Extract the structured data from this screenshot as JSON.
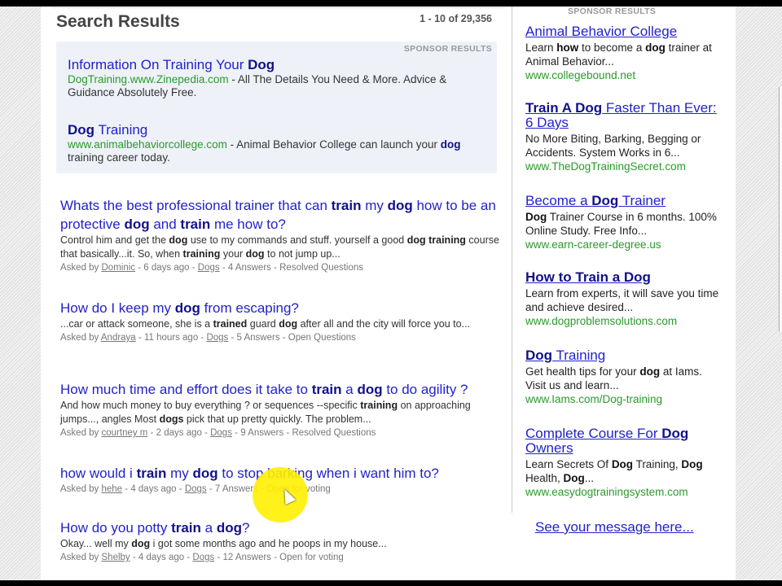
{
  "header": {
    "title": "Search Results",
    "count": "1 - 10 of 29,356"
  },
  "sponsor_label": "SPONSOR RESULTS",
  "top_ads": [
    {
      "title": [
        {
          "t": "Information On Training Your "
        },
        {
          "t": "Dog",
          "b": true
        }
      ],
      "url": "DogTraining.www.Zinepedia.com",
      "desc": [
        {
          "t": " - All The Details You Need & More. Advice & Guidance Absolutely Free."
        }
      ]
    },
    {
      "title": [
        {
          "t": "Dog",
          "b": true
        },
        {
          "t": " Training"
        }
      ],
      "url": "www.animalbehaviorcollege.com",
      "desc": [
        {
          "t": " - Animal Behavior College can launch your "
        },
        {
          "t": "dog",
          "b": true
        },
        {
          "t": " training career today."
        }
      ]
    }
  ],
  "results": [
    {
      "title": [
        {
          "t": "Whats the best professional trainer that can "
        },
        {
          "t": "train",
          "b": true
        },
        {
          "t": " my "
        },
        {
          "t": "dog",
          "b": true
        },
        {
          "t": " how to be an protective "
        },
        {
          "t": "dog",
          "b": true
        },
        {
          "t": " and "
        },
        {
          "t": "train",
          "b": true
        },
        {
          "t": " me how to?"
        }
      ],
      "snippet": [
        {
          "t": "Control him and get the "
        },
        {
          "t": "dog",
          "b": true
        },
        {
          "t": " use to my commands and stuff. yourself a good "
        },
        {
          "t": "dog",
          "b": true
        },
        {
          "t": " "
        },
        {
          "t": "training",
          "b": true
        },
        {
          "t": " course that basically...it. So, when "
        },
        {
          "t": "training",
          "b": true
        },
        {
          "t": " your "
        },
        {
          "t": "dog",
          "b": true
        },
        {
          "t": " to not jump up..."
        }
      ],
      "asked_by": "Asked by ",
      "user": "Dominic",
      "time": " - 6 days ago - ",
      "category": "Dogs",
      "tail": " - 4 Answers - Resolved Questions"
    },
    {
      "title": [
        {
          "t": "How do I keep my "
        },
        {
          "t": "dog",
          "b": true
        },
        {
          "t": " from escaping?"
        }
      ],
      "snippet": [
        {
          "t": "...car or attack someone, she is a "
        },
        {
          "t": "trained",
          "b": true
        },
        {
          "t": " guard "
        },
        {
          "t": "dog",
          "b": true
        },
        {
          "t": " after all and the city will force you to..."
        }
      ],
      "asked_by": "Asked by ",
      "user": "Andraya",
      "time": " - 11 hours ago - ",
      "category": "Dogs",
      "tail": " - 5 Answers - Open Questions"
    },
    {
      "title": [
        {
          "t": "How much time and effort does it take to "
        },
        {
          "t": "train",
          "b": true
        },
        {
          "t": " a "
        },
        {
          "t": "dog",
          "b": true
        },
        {
          "t": " to do agility ?"
        }
      ],
      "snippet": [
        {
          "t": "And how much money to buy everything ? or sequences --specific "
        },
        {
          "t": "training",
          "b": true
        },
        {
          "t": " on approaching jumps..., angles Most "
        },
        {
          "t": "dogs",
          "b": true
        },
        {
          "t": " pick that up pretty quickly. The problem..."
        }
      ],
      "asked_by": "Asked by ",
      "user": "courtney m",
      "time": " - 2 days ago - ",
      "category": "Dogs",
      "tail": " - 9 Answers - Resolved Questions"
    },
    {
      "title": [
        {
          "t": "how would i "
        },
        {
          "t": "train",
          "b": true
        },
        {
          "t": " my "
        },
        {
          "t": "dog",
          "b": true
        },
        {
          "t": " to stop barking when i want him to?"
        }
      ],
      "snippet": [],
      "asked_by": "Asked by ",
      "user": "hehe",
      "time": " - 4 days ago - ",
      "category": "Dogs",
      "tail": " - 7 Answers - Open for voting"
    },
    {
      "title": [
        {
          "t": "How do you potty "
        },
        {
          "t": "train",
          "b": true
        },
        {
          "t": " a "
        },
        {
          "t": "dog",
          "b": true
        },
        {
          "t": "?"
        }
      ],
      "snippet": [
        {
          "t": "Okay... well my "
        },
        {
          "t": "dog",
          "b": true
        },
        {
          "t": " i got some months ago and he poops in my house..."
        }
      ],
      "asked_by": "Asked by ",
      "user": "Shelby",
      "time": " - 4 days ago - ",
      "category": "Dogs",
      "tail": " - 12 Answers - Open for voting"
    }
  ],
  "side_ads": [
    {
      "title": [
        {
          "t": "Animal Behavior College"
        }
      ],
      "desc": [
        {
          "t": "Learn "
        },
        {
          "t": "how",
          "b": true
        },
        {
          "t": " to become a "
        },
        {
          "t": "dog",
          "b": true
        },
        {
          "t": " trainer at Animal Behavior..."
        }
      ],
      "url": "www.collegebound.net"
    },
    {
      "title": [
        {
          "t": "Train A Dog",
          "b": true
        },
        {
          "t": " Faster Than Ever: 6 Days"
        }
      ],
      "desc": [
        {
          "t": "No More Biting, Barking, Begging or Accidents. System Works in 6..."
        }
      ],
      "url": "www.TheDogTrainingSecret.com"
    },
    {
      "title": [
        {
          "t": "Become a "
        },
        {
          "t": "Dog",
          "b": true
        },
        {
          "t": " Trainer"
        }
      ],
      "desc": [
        {
          "t": "Dog",
          "b": true
        },
        {
          "t": " Trainer Course in 6 months. 100% Online Study. Free Info..."
        }
      ],
      "url": "www.earn-career-degree.us"
    },
    {
      "title": [
        {
          "t": "How to Train a Dog",
          "b": true
        }
      ],
      "desc": [
        {
          "t": "Learn from experts, it will save you time and achieve desired..."
        }
      ],
      "url": "www.dogproblemsolutions.com"
    },
    {
      "title": [
        {
          "t": "Dog",
          "b": true
        },
        {
          "t": " Training"
        }
      ],
      "desc": [
        {
          "t": "Get health tips for your "
        },
        {
          "t": "dog",
          "b": true
        },
        {
          "t": " at Iams. Visit us and learn..."
        }
      ],
      "url": "www.Iams.com/Dog-training"
    },
    {
      "title": [
        {
          "t": "Complete Course For "
        },
        {
          "t": "Dog",
          "b": true
        },
        {
          "t": " Owners"
        }
      ],
      "desc": [
        {
          "t": "Learn Secrets Of "
        },
        {
          "t": "Dog",
          "b": true
        },
        {
          "t": " Training, "
        },
        {
          "t": "Dog",
          "b": true
        },
        {
          "t": " Health, "
        },
        {
          "t": "Dog",
          "b": true
        },
        {
          "t": "..."
        }
      ],
      "url": "www.easydogtrainingsystem.com"
    }
  ],
  "see_message": "See your message here..."
}
